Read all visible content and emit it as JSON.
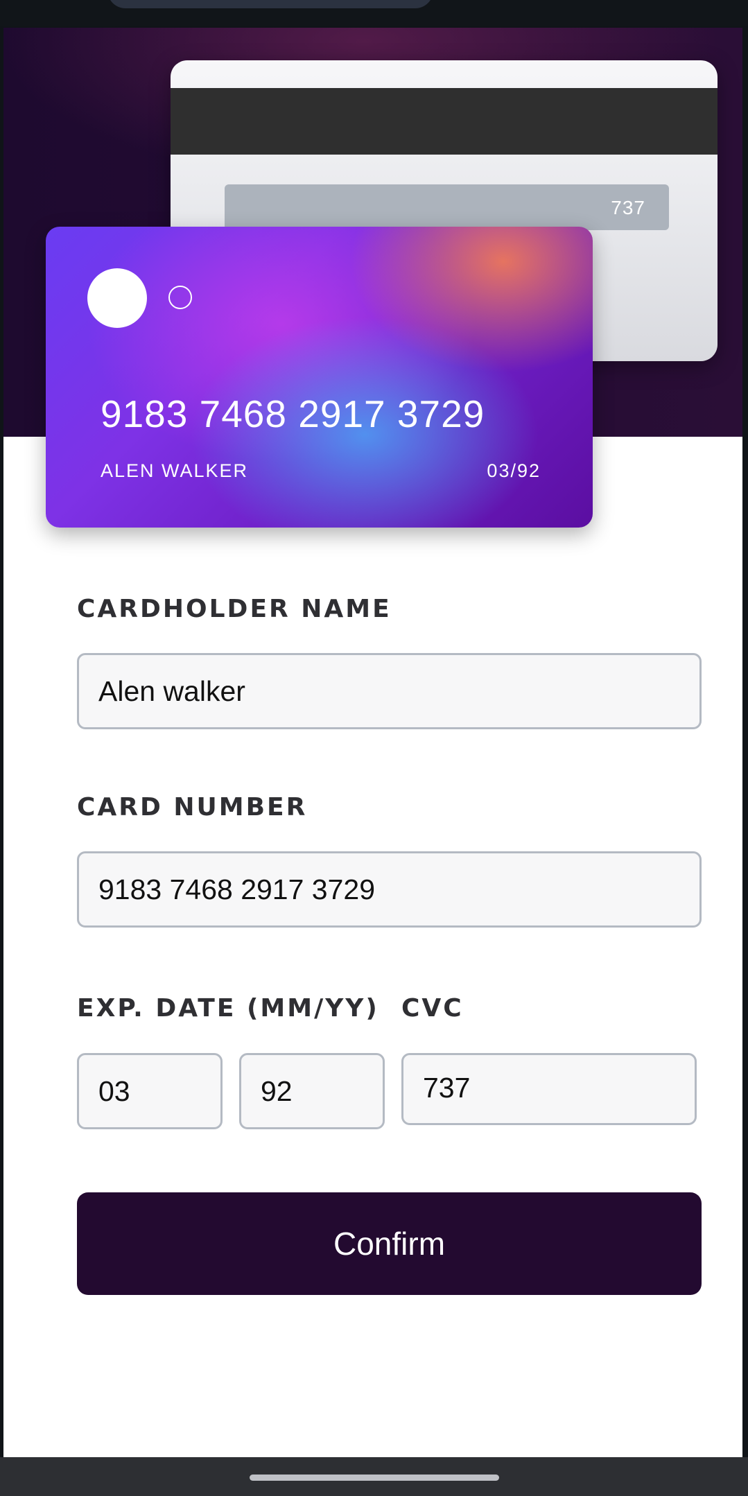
{
  "card_back": {
    "cvc": "737"
  },
  "card_front": {
    "number": "9183 7468 2917 3729",
    "holder": "ALEN WALKER",
    "expiry": "03/92"
  },
  "form": {
    "cardholder_label": "CARDHOLDER NAME",
    "cardholder_value": "Alen walker",
    "number_label": "CARD NUMBER",
    "number_value": "9183 7468 2917 3729",
    "exp_label": "EXP. DATE (MM/YY)",
    "exp_month_value": "03",
    "exp_year_value": "92",
    "cvc_label": "CVC",
    "cvc_value": "737",
    "confirm_label": "Confirm"
  },
  "colors": {
    "hero_background": "#1e0a2f",
    "button_background": "#230a30",
    "input_border": "#b4bac3",
    "label_text": "#2f2f33"
  }
}
